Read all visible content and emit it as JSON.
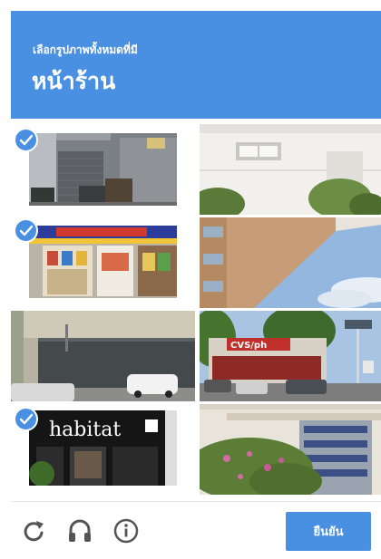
{
  "header": {
    "instruction": "เลือกรูปภาพทั้งหมดที่มี",
    "target": "หน้าร้าน",
    "color": "#4a90e2"
  },
  "grid": {
    "tiles": [
      {
        "id": 1,
        "scene": "garage-door-building",
        "selected": true
      },
      {
        "id": 2,
        "scene": "white-wall-building",
        "selected": false
      },
      {
        "id": 3,
        "scene": "convenience-store-front",
        "selected": true
      },
      {
        "id": 4,
        "scene": "building-corner-sky",
        "selected": false
      },
      {
        "id": 5,
        "scene": "sound-wall-street",
        "selected": false
      },
      {
        "id": 6,
        "scene": "cvs-pharmacy-parking",
        "selected": false
      },
      {
        "id": 7,
        "scene": "habitat-store-front",
        "selected": true,
        "sign_text": "habitat"
      },
      {
        "id": 8,
        "scene": "gate-and-bushes",
        "selected": false
      }
    ]
  },
  "toolbar": {
    "reload_icon": "reload-icon",
    "audio_icon": "headphones-icon",
    "info_icon": "info-icon",
    "verify_label": "ยืนยัน"
  }
}
